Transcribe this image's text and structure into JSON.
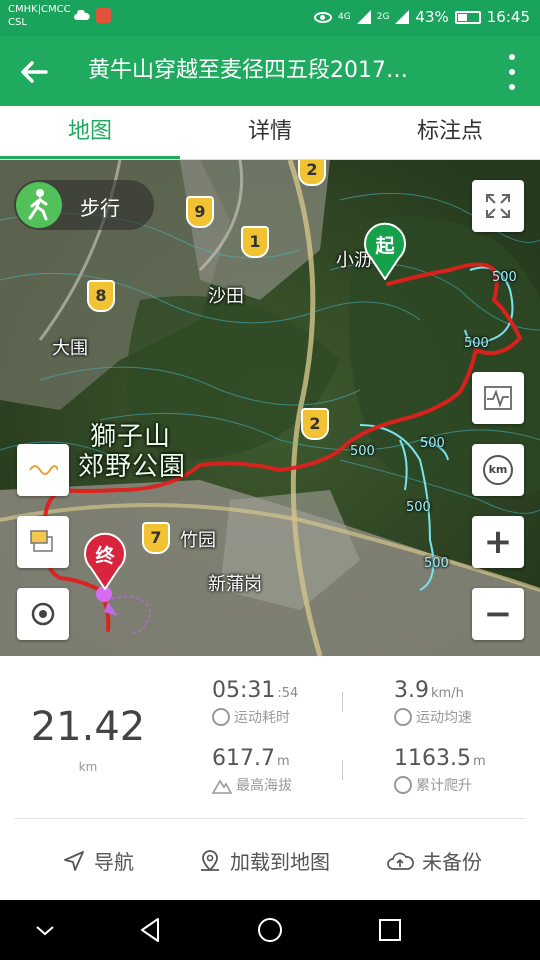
{
  "statusbar": {
    "carrier_line1": "CMHK|CMCC",
    "carrier_line2": "CSL",
    "signal1": "4G",
    "signal2": "2G",
    "battery_text": "43%",
    "battery_level": 0.43,
    "time": "16:45"
  },
  "appbar": {
    "title": "黄牛山穿越至麦径四五段2017…"
  },
  "tabs": [
    {
      "label": "地图",
      "active": true
    },
    {
      "label": "详情",
      "active": false
    },
    {
      "label": "标注点",
      "active": false
    }
  ],
  "map": {
    "mode_label": "步行",
    "place_labels": [
      "沙田",
      "大围",
      "竹园",
      "新蒲岗",
      "小沥"
    ],
    "park_label_line1": "獅子山",
    "park_label_line2": "郊野公園",
    "route_numbers": [
      "2",
      "9",
      "1",
      "8",
      "2",
      "7"
    ],
    "contour_labels": [
      "500",
      "500",
      "500",
      "500",
      "500",
      "500"
    ],
    "start_marker": "起",
    "end_marker": "终",
    "zoom_in": "+",
    "zoom_out": "−",
    "km_button": "km"
  },
  "stats": {
    "distance": "21.42",
    "distance_unit": "km",
    "duration": "05:31",
    "duration_seconds": ":54",
    "duration_label": "运动耗时",
    "avg_speed": "3.9",
    "avg_speed_unit": "km/h",
    "avg_speed_label": "运动均速",
    "max_altitude": "617.7",
    "max_altitude_unit": "m",
    "max_altitude_label": "最高海拔",
    "total_climb": "1163.5",
    "total_climb_unit": "m",
    "total_climb_label": "累计爬升"
  },
  "actions": {
    "navigate": "导航",
    "load_to_map": "加载到地图",
    "backup": "未备份"
  },
  "colors": {
    "brand_green": "#1faa60",
    "route_red": "#e0201c",
    "contour_cyan": "#5fe0e8"
  }
}
